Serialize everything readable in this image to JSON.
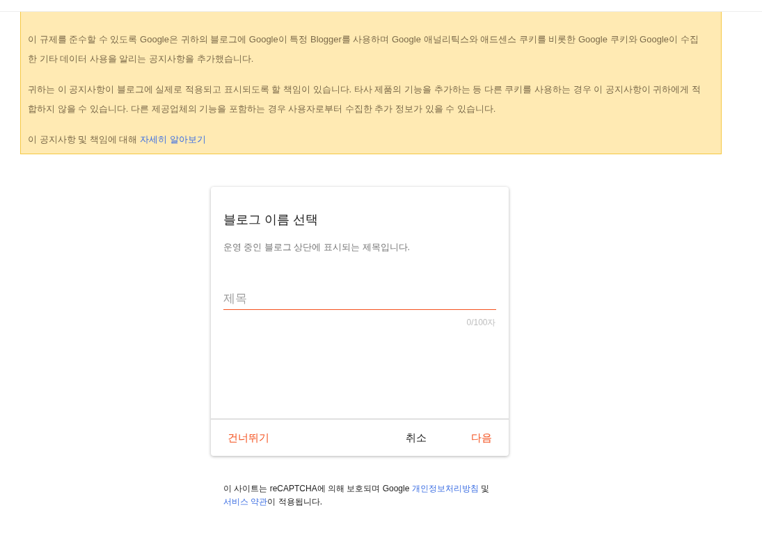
{
  "notice": {
    "paragraphs": [
      [
        {
          "kind": "text",
          "text": "이 규제를 준수할 수 있도록 Google은 귀하의 블로그에 Google이 특정 Blogger를 사용하며 Google 애널리틱스와 애드센스 쿠키를 비롯한 Google 쿠키와 Google이 수집한 기타 데이터 사용을 알리는 공지사항을 추가했습니다."
        }
      ],
      [
        {
          "kind": "text",
          "text": "귀하는 이 공지사항이 블로그에 실제로 적용되고 표시되도록 할 책임이 있습니다. 타사 제품의 기능을 추가하는 등 다른 쿠키를 사용하는 경우 이 공지사항이 귀하에게 적합하지 않을 수 있습니다. 다른 제공업체의 기능을 포함하는 경우 사용자로부터 수집한 추가 정보가 있을 수 있습니다."
        }
      ],
      [
        {
          "kind": "text",
          "text": "이 공지사항 및 책임에 대해 "
        },
        {
          "kind": "link",
          "text": "자세히 알아보기"
        }
      ]
    ]
  },
  "dialog": {
    "title": "블로그 이름 선택",
    "description": "운영 중인 블로그 상단에 표시되는 제목입니다.",
    "field": {
      "placeholder": "제목",
      "counter": "0/100자",
      "focused": true
    },
    "buttons": [
      {
        "label": "건너뛰기",
        "kind": "accent"
      },
      {
        "label": "취소",
        "kind": "plain"
      },
      {
        "label": "다음",
        "kind": "accent"
      }
    ]
  },
  "footer": [
    {
      "kind": "text",
      "text": "이 사이트는 reCAPTCHA에 의해 보호되며 Google "
    },
    {
      "kind": "link",
      "text": "개인정보처리방침"
    },
    {
      "kind": "text",
      "text": " 및 "
    },
    {
      "kind": "link",
      "text": "서비스 약관"
    },
    {
      "kind": "text",
      "text": "이 적용됩니다."
    }
  ]
}
